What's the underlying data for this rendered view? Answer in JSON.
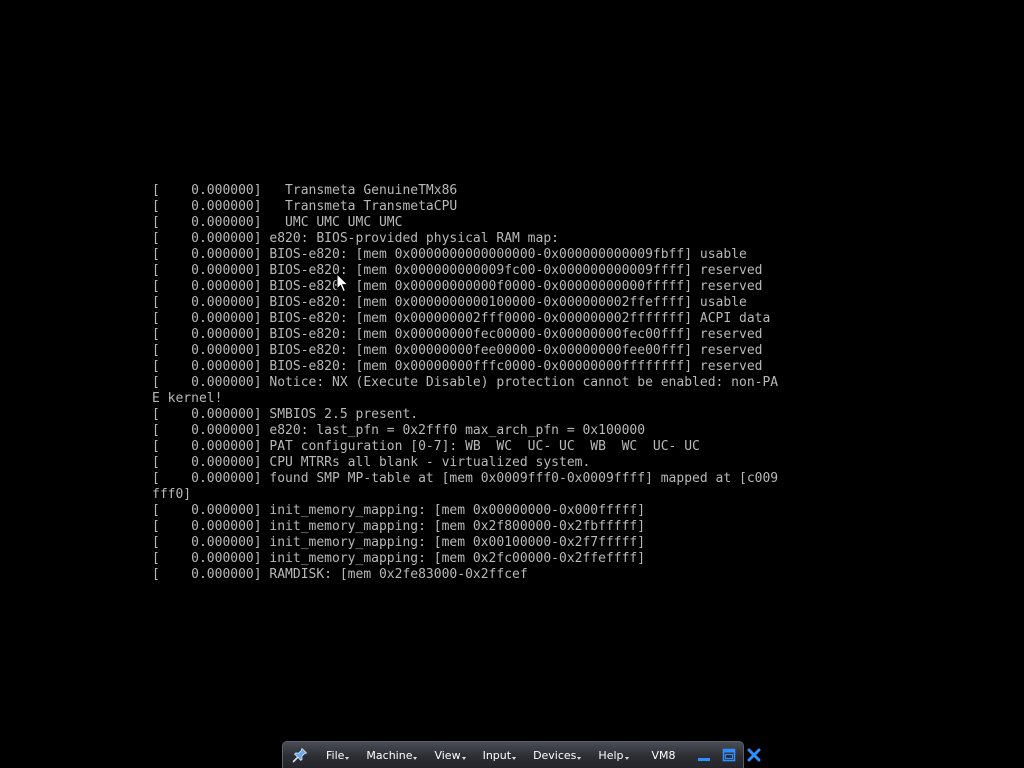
{
  "console": {
    "lines": [
      "[    0.000000]   Transmeta GenuineTMx86",
      "[    0.000000]   Transmeta TransmetaCPU",
      "[    0.000000]   UMC UMC UMC UMC",
      "[    0.000000] e820: BIOS-provided physical RAM map:",
      "[    0.000000] BIOS-e820: [mem 0x0000000000000000-0x000000000009fbff] usable",
      "[    0.000000] BIOS-e820: [mem 0x000000000009fc00-0x000000000009ffff] reserved",
      "[    0.000000] BIOS-e820: [mem 0x00000000000f0000-0x00000000000fffff] reserved",
      "[    0.000000] BIOS-e820: [mem 0x0000000000100000-0x000000002ffeffff] usable",
      "[    0.000000] BIOS-e820: [mem 0x000000002fff0000-0x000000002fffffff] ACPI data",
      "[    0.000000] BIOS-e820: [mem 0x00000000fec00000-0x00000000fec00fff] reserved",
      "[    0.000000] BIOS-e820: [mem 0x00000000fee00000-0x00000000fee00fff] reserved",
      "[    0.000000] BIOS-e820: [mem 0x00000000fffc0000-0x00000000ffffffff] reserved",
      "[    0.000000] Notice: NX (Execute Disable) protection cannot be enabled: non-PA",
      "E kernel!",
      "[    0.000000] SMBIOS 2.5 present.",
      "[    0.000000] e820: last_pfn = 0x2fff0 max_arch_pfn = 0x100000",
      "[    0.000000] PAT configuration [0-7]: WB  WC  UC- UC  WB  WC  UC- UC",
      "[    0.000000] CPU MTRRs all blank - virtualized system.",
      "[    0.000000] found SMP MP-table at [mem 0x0009fff0-0x0009ffff] mapped at [c009",
      "fff0]",
      "[    0.000000] init_memory_mapping: [mem 0x00000000-0x000fffff]",
      "[    0.000000] init_memory_mapping: [mem 0x2f800000-0x2fbfffff]",
      "[    0.000000] init_memory_mapping: [mem 0x00100000-0x2f7fffff]",
      "[    0.000000] init_memory_mapping: [mem 0x2fc00000-0x2ffeffff]",
      "[    0.000000] RAMDISK: [mem 0x2fe83000-0x2ffcef"
    ],
    "text_color": "#b8b8b8",
    "background_color": "#000000"
  },
  "toolbar": {
    "pin_icon": "pin-icon",
    "menus": {
      "file": "File",
      "machine": "Machine",
      "view": "View",
      "input": "Input",
      "devices": "Devices",
      "help": "Help"
    },
    "vm_name": "VM8",
    "minimize_icon": "minimize-icon",
    "restore_icon": "restore-icon",
    "close_icon": "close-icon",
    "accent_color": "#2f8fff"
  },
  "pointer": {
    "icon": "mouse-cursor-icon"
  }
}
